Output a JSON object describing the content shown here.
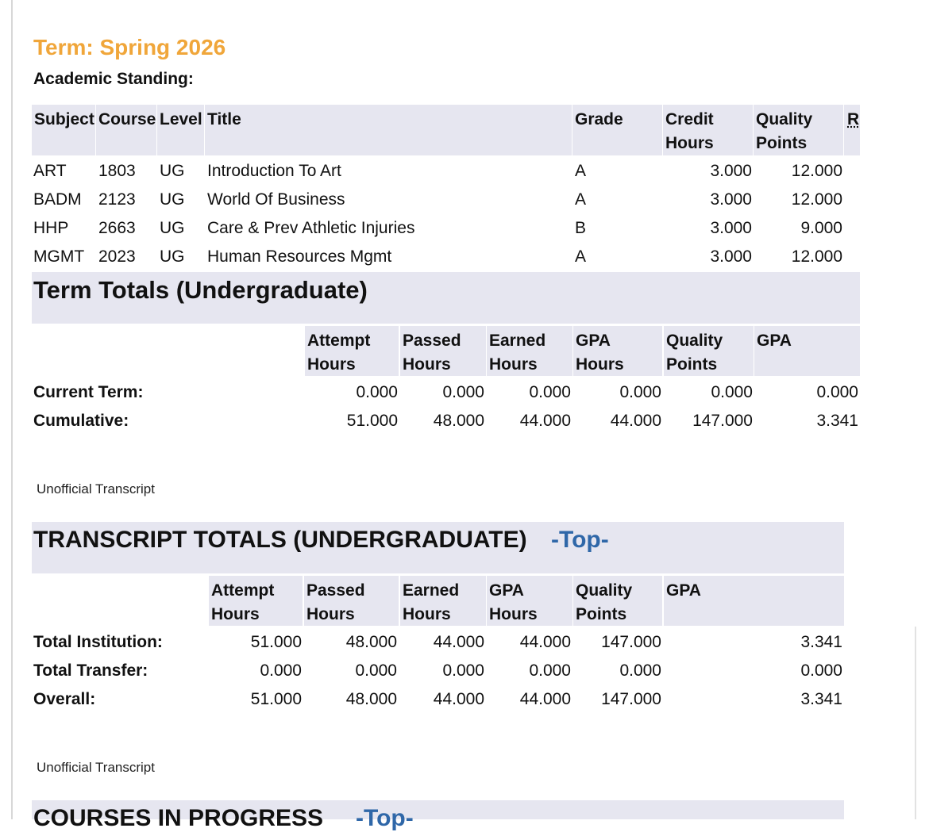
{
  "page": {
    "unofficial_label": "Unofficial Transcript",
    "top_link": "-Top-"
  },
  "term": {
    "title": "Term: Spring 2026",
    "standing_label": "Academic Standing:",
    "headers": [
      "Subject",
      "Course",
      "Level",
      "Title",
      "Grade",
      "Credit\nHours",
      "Quality\nPoints",
      "R"
    ],
    "courses": [
      {
        "subject": "ART",
        "course": "1803",
        "level": "UG",
        "title": "Introduction To Art",
        "grade": "A",
        "credit": "3.000",
        "quality": "12.000"
      },
      {
        "subject": "BADM",
        "course": "2123",
        "level": "UG",
        "title": "World Of Business",
        "grade": "A",
        "credit": "3.000",
        "quality": "12.000"
      },
      {
        "subject": "HHP",
        "course": "2663",
        "level": "UG",
        "title": "Care & Prev Athletic Injuries",
        "grade": "B",
        "credit": "3.000",
        "quality": "9.000"
      },
      {
        "subject": "MGMT",
        "course": "2023",
        "level": "UG",
        "title": "Human Resources Mgmt",
        "grade": "A",
        "credit": "3.000",
        "quality": "12.000"
      }
    ]
  },
  "term_totals": {
    "title": "Term Totals (Undergraduate)",
    "headers": [
      "Attempt\nHours",
      "Passed\nHours",
      "Earned\nHours",
      "GPA\nHours",
      "Quality\nPoints",
      "GPA"
    ],
    "rows": [
      {
        "label": "Current Term:",
        "values": [
          "0.000",
          "0.000",
          "0.000",
          "0.000",
          "0.000",
          "0.000"
        ]
      },
      {
        "label": "Cumulative:",
        "values": [
          "51.000",
          "48.000",
          "44.000",
          "44.000",
          "147.000",
          "3.341"
        ]
      }
    ]
  },
  "transcript_totals": {
    "title": "TRANSCRIPT TOTALS (UNDERGRADUATE)",
    "headers": [
      "Attempt\nHours",
      "Passed\nHours",
      "Earned\nHours",
      "GPA\nHours",
      "Quality\nPoints",
      "GPA"
    ],
    "rows": [
      {
        "label": "Total Institution:",
        "values": [
          "51.000",
          "48.000",
          "44.000",
          "44.000",
          "147.000",
          "3.341"
        ]
      },
      {
        "label": "Total Transfer:",
        "values": [
          "0.000",
          "0.000",
          "0.000",
          "0.000",
          "0.000",
          "0.000"
        ]
      },
      {
        "label": "Overall:",
        "values": [
          "51.000",
          "48.000",
          "44.000",
          "44.000",
          "147.000",
          "3.341"
        ]
      }
    ]
  },
  "in_progress": {
    "title": "COURSES IN PROGRESS"
  }
}
